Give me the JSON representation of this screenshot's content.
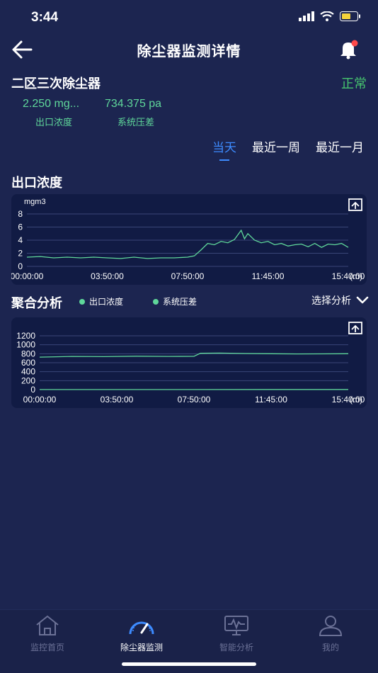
{
  "status": {
    "time": "3:44"
  },
  "header": {
    "title": "除尘器监测详情"
  },
  "device": {
    "name": "二区三次除尘器",
    "status": "正常",
    "metrics": [
      {
        "value": "2.250 mg...",
        "label": "出口浓度"
      },
      {
        "value": "734.375 pa",
        "label": "系统压差"
      }
    ]
  },
  "tabs": [
    {
      "label": "当天",
      "active": true
    },
    {
      "label": "最近一周",
      "active": false
    },
    {
      "label": "最近一月",
      "active": false
    }
  ],
  "outlet_section": {
    "title": "出口浓度"
  },
  "aggregate_section": {
    "title": "聚合分析",
    "legend": [
      "出口浓度",
      "系统压差"
    ],
    "select_label": "选择分析"
  },
  "colors": {
    "background": "#1c2550",
    "card": "#111b44",
    "line": "#5fd79a",
    "accent": "#3d8bff",
    "ok": "#46c46e"
  },
  "chart_data": [
    {
      "type": "line",
      "ylabel": "mgm3",
      "xunit": "(m)",
      "ylim": [
        0,
        8
      ],
      "yticks": [
        "8",
        "6",
        "4",
        "2",
        "0"
      ],
      "xticks": [
        "00:00:00",
        "03:50:00",
        "07:50:00",
        "11:45:00",
        "15:40:00"
      ],
      "xlim": [
        0,
        960
      ],
      "grid": true,
      "series": [
        {
          "values": [
            [
              0,
              1.4
            ],
            [
              40,
              1.5
            ],
            [
              80,
              1.3
            ],
            [
              120,
              1.4
            ],
            [
              160,
              1.3
            ],
            [
              200,
              1.4
            ],
            [
              240,
              1.3
            ],
            [
              280,
              1.2
            ],
            [
              320,
              1.4
            ],
            [
              360,
              1.2
            ],
            [
              400,
              1.3
            ],
            [
              440,
              1.3
            ],
            [
              480,
              1.4
            ],
            [
              500,
              1.6
            ],
            [
              520,
              2.5
            ],
            [
              540,
              3.5
            ],
            [
              560,
              3.3
            ],
            [
              580,
              3.8
            ],
            [
              600,
              3.6
            ],
            [
              620,
              4.1
            ],
            [
              640,
              5.5
            ],
            [
              650,
              4.2
            ],
            [
              660,
              5.0
            ],
            [
              680,
              4.0
            ],
            [
              700,
              3.6
            ],
            [
              720,
              3.8
            ],
            [
              740,
              3.3
            ],
            [
              760,
              3.5
            ],
            [
              780,
              3.1
            ],
            [
              800,
              3.3
            ],
            [
              820,
              3.4
            ],
            [
              840,
              3.0
            ],
            [
              860,
              3.5
            ],
            [
              880,
              2.9
            ],
            [
              900,
              3.4
            ],
            [
              920,
              3.3
            ],
            [
              940,
              3.5
            ],
            [
              960,
              2.9
            ]
          ]
        }
      ]
    },
    {
      "type": "line",
      "ylim": [
        0,
        1200
      ],
      "yticks": [
        "1200",
        "1000",
        "800",
        "600",
        "400",
        "200",
        "0"
      ],
      "xticks": [
        "00:00:00",
        "03:50:00",
        "07:50:00",
        "11:45:00",
        "15:40:00"
      ],
      "xunit": "(m)",
      "xlim": [
        0,
        960
      ],
      "grid": true,
      "legend": "top",
      "series": [
        {
          "name": "出口浓度",
          "values": [
            [
              0,
              2
            ],
            [
              240,
              2
            ],
            [
              480,
              2
            ],
            [
              720,
              3
            ],
            [
              960,
              3
            ]
          ]
        },
        {
          "name": "系统压差",
          "values": [
            [
              0,
              725
            ],
            [
              100,
              740
            ],
            [
              200,
              735
            ],
            [
              300,
              745
            ],
            [
              400,
              740
            ],
            [
              480,
              742
            ],
            [
              500,
              810
            ],
            [
              560,
              815
            ],
            [
              640,
              805
            ],
            [
              720,
              800
            ],
            [
              800,
              795
            ],
            [
              880,
              798
            ],
            [
              960,
              800
            ]
          ]
        }
      ]
    }
  ],
  "nav": [
    {
      "label": "监控首页",
      "icon": "home-icon",
      "active": false
    },
    {
      "label": "除尘器监测",
      "icon": "gauge-icon",
      "active": true
    },
    {
      "label": "智能分析",
      "icon": "monitor-icon",
      "active": false
    },
    {
      "label": "我的",
      "icon": "user-icon",
      "active": false
    }
  ]
}
